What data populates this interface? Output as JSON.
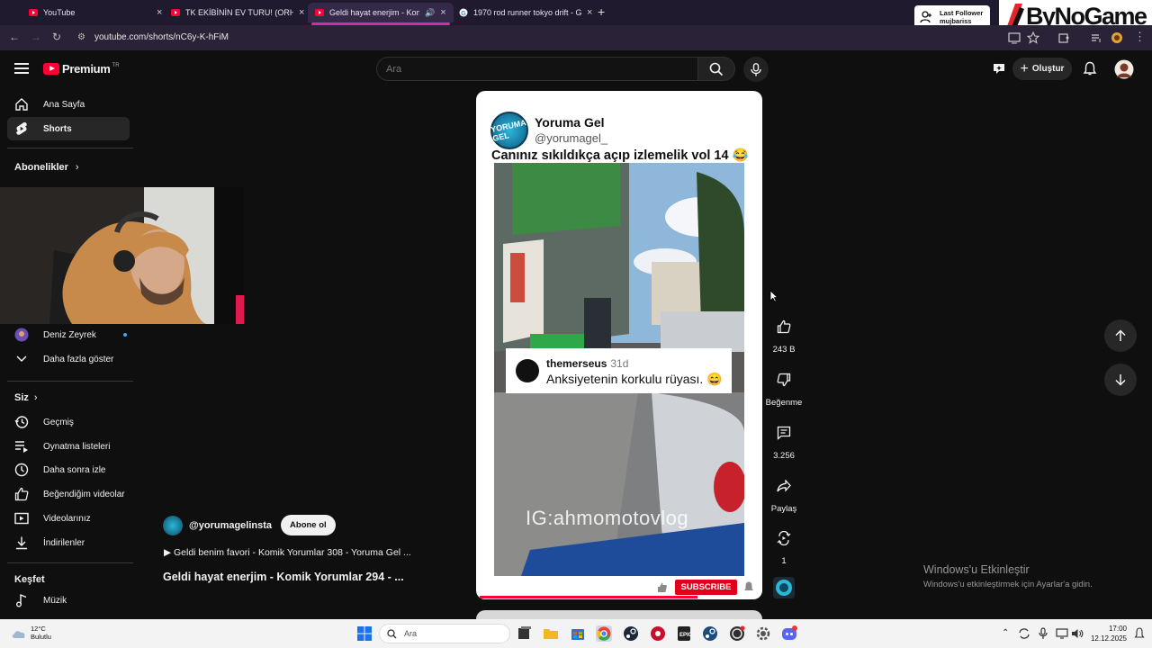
{
  "browser": {
    "tabs": [
      {
        "label": "YouTube",
        "active": false
      },
      {
        "label": "TK EKİBİNİN EV TURU! (ORHAN",
        "active": false
      },
      {
        "label": "Geldi hayat enerjim - Komik",
        "active": true
      },
      {
        "label": "1970 rod runner tokyo drift - G",
        "active": false
      }
    ],
    "url": "youtube.com/shorts/nC6y-K-hFiM",
    "overlay_last_follower": {
      "title": "Last Follower",
      "name": "mujbariss"
    },
    "overlay_brand": "ByNoGame"
  },
  "header": {
    "logo_text": "Premium",
    "logo_region": "TR",
    "search_placeholder": "Ara",
    "create_label": "Oluştur"
  },
  "sidebar": {
    "top_items": [
      {
        "label": "Ana Sayfa",
        "icon": "home-icon"
      },
      {
        "label": "Shorts",
        "icon": "shorts-icon",
        "active": true
      }
    ],
    "subscriptions_title": "Abonelikler",
    "subscription_items": [
      {
        "label": "Deniz Zeyrek",
        "new": true
      }
    ],
    "show_more": "Daha fazla göster",
    "you_title": "Siz",
    "you_items": [
      {
        "label": "Geçmiş",
        "icon": "history-icon"
      },
      {
        "label": "Oynatma listeleri",
        "icon": "playlists-icon"
      },
      {
        "label": "Daha sonra izle",
        "icon": "watch-later-icon"
      },
      {
        "label": "Beğendiğim videolar",
        "icon": "liked-icon"
      },
      {
        "label": "Videolarınız",
        "icon": "your-videos-icon"
      },
      {
        "label": "İndirilenler",
        "icon": "downloads-icon"
      }
    ],
    "explore_title": "Keşfet",
    "explore_items": [
      {
        "label": "Müzik",
        "icon": "music-icon"
      }
    ]
  },
  "short": {
    "account_name": "Yoruma Gel",
    "account_handle": "@yorumagel_",
    "avatar_text": "YORUMA GEL",
    "caption": "Canınız sıkıldıkça açıp izlemelik vol 14 😂",
    "comment_user": "themerseus",
    "comment_time": "31d",
    "comment_text": "Anksiyetenin korkulu rüyası. 😄",
    "watermark": "IG:ahmomotovlog",
    "subscribe_label": "SUBSCRIBE",
    "progress": 0.78
  },
  "actions": {
    "like_count": "243 B",
    "dislike_label": "Beğenme",
    "comment_count": "3.256",
    "share_label": "Paylaş",
    "remix_count": "1"
  },
  "channel": {
    "handle": "@yorumagelinsta",
    "subscribe_label": "Abone ol",
    "playlist_line": "▶  Geldi benim favori - Komik Yorumlar 308 - Yoruma Gel ...",
    "title": "Geldi hayat enerjim - Komik Yorumlar 294 - ..."
  },
  "windows_activation": {
    "title": "Windows'u Etkinleştir",
    "subtitle": "Windows'u etkinleştirmek için Ayarlar'a gidin."
  },
  "taskbar": {
    "weather_temp": "12°C",
    "weather_desc": "Bulutlu",
    "search_label": "Ara",
    "time": "17:00",
    "date": "12.12.2025"
  },
  "colors": {
    "accent_red": "#ff0033",
    "tab_accent": "#d62ba3",
    "background": "#0f0f0f"
  }
}
